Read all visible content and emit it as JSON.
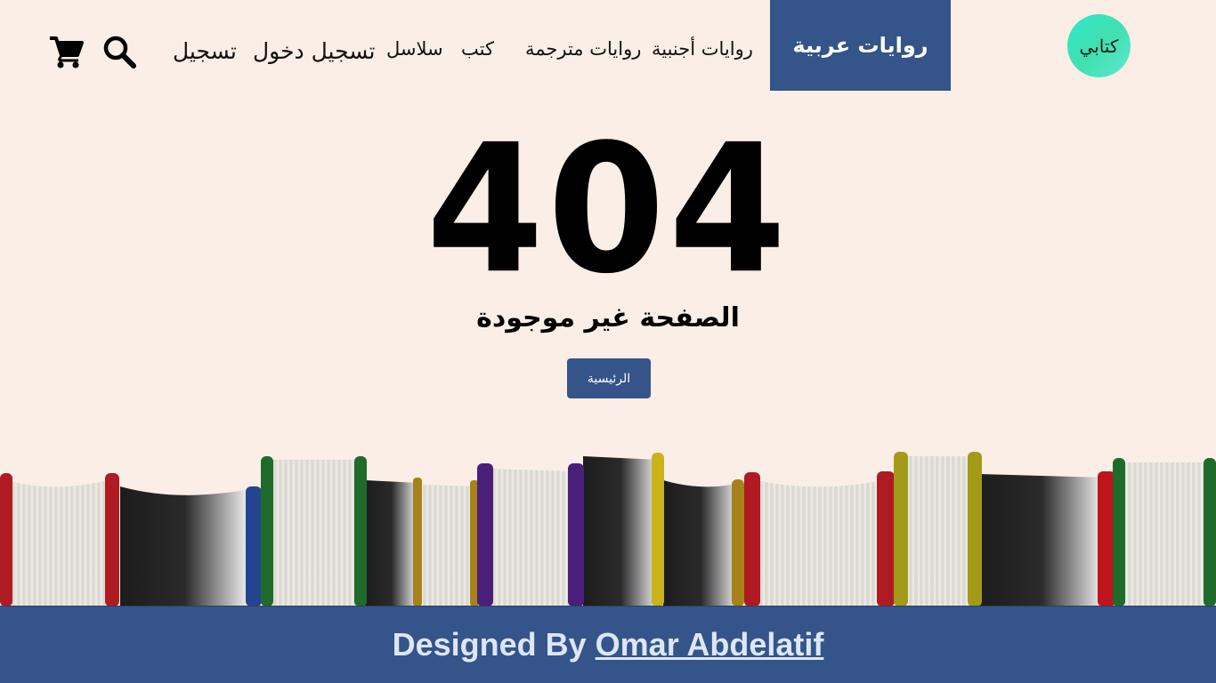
{
  "brand": {
    "logo_text": "كتابي"
  },
  "nav": {
    "active": "روايات عربية",
    "links": [
      "روايات أجنبية",
      "روايات مترجمة",
      "كتب",
      "سلاسل"
    ],
    "login": "تسجيل دخول",
    "register": "تسجيل",
    "icons": {
      "search": "search-icon",
      "cart": "cart-icon"
    }
  },
  "main": {
    "error_code": "404",
    "error_message": "الصفحة غير موجودة",
    "home_button": "الرئيسية"
  },
  "footer": {
    "prefix": "Designed By",
    "author": "Omar Abdelatif"
  },
  "colors": {
    "background": "#fbeee6",
    "primary": "#34548a",
    "logo_gradient": [
      "#2fe7c9",
      "#5ce8d0"
    ]
  }
}
